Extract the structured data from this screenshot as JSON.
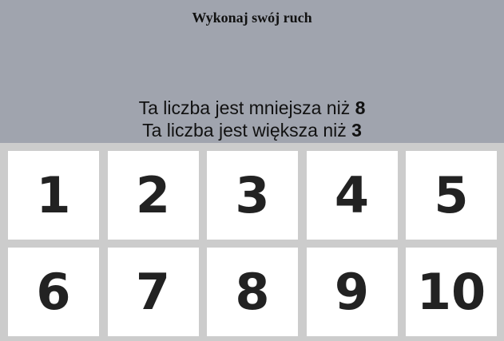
{
  "header": {
    "title": "Wykonaj swój ruch"
  },
  "hints": [
    {
      "text": "Ta liczba jest mniejsza niż ",
      "value": "8"
    },
    {
      "text": "Ta liczba jest większa niż ",
      "value": "3"
    }
  ],
  "tiles": [
    "1",
    "2",
    "3",
    "4",
    "5",
    "6",
    "7",
    "8",
    "9",
    "10"
  ]
}
